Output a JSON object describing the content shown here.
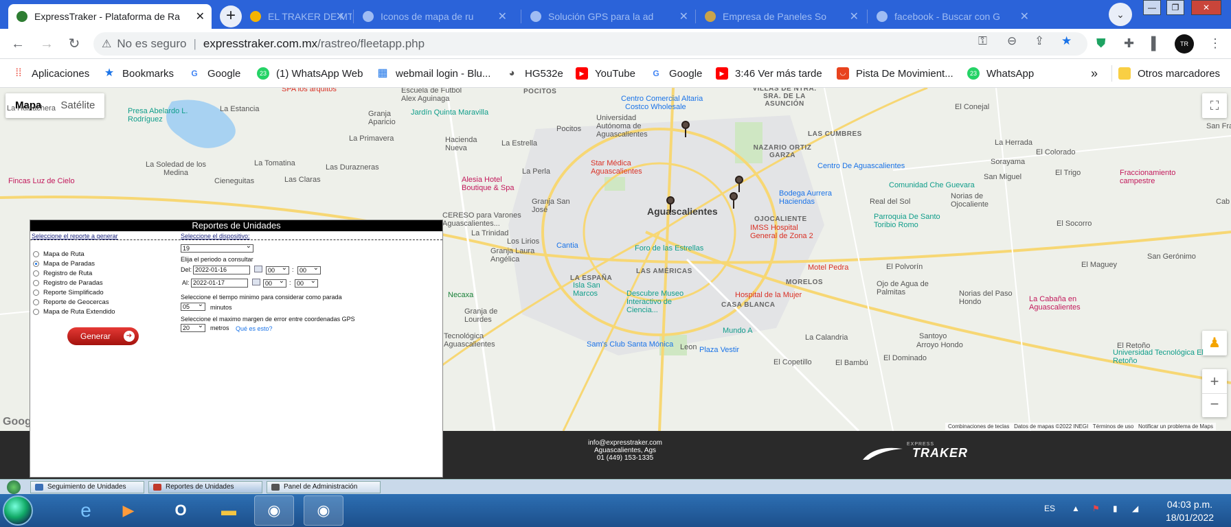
{
  "browser": {
    "tabs": [
      {
        "title": "ExpressTraker - Plataforma de Ra",
        "active": true
      },
      {
        "title": "EL TRAKER DE MT"
      },
      {
        "title": "Iconos de mapa de ru"
      },
      {
        "title": "Solución GPS para la ad"
      },
      {
        "title": "Empresa de Paneles So"
      },
      {
        "title": "facebook - Buscar con G"
      }
    ],
    "new_tab": "+",
    "close_glyph": "✕",
    "window_controls": {
      "minimize": "—",
      "restore": "❐",
      "close": "✕"
    }
  },
  "address_bar": {
    "security_label": "No es seguro",
    "domain": "expresstraker.com.mx",
    "path": "/rastreo/fleetapp.php"
  },
  "bookmarks": [
    {
      "label": "Aplicaciones",
      "icon": "apps-grid-icon"
    },
    {
      "label": "Bookmarks",
      "icon": "star-icon"
    },
    {
      "label": "Google",
      "icon": "google-icon"
    },
    {
      "label": "(1) WhatsApp Web",
      "icon": "whatsapp-icon",
      "badge": "23"
    },
    {
      "label": "webmail login - Blu...",
      "icon": "grid-icon"
    },
    {
      "label": "HG532e",
      "icon": "globe-icon"
    },
    {
      "label": "YouTube",
      "icon": "youtube-icon"
    },
    {
      "label": "Google",
      "icon": "google-icon"
    },
    {
      "label": "3:46 Ver más tarde",
      "icon": "youtube-icon"
    },
    {
      "label": "Pista De Movimient...",
      "icon": "tracker-icon"
    },
    {
      "label": "WhatsApp",
      "icon": "whatsapp-icon",
      "badge": "23"
    }
  ],
  "bookmarks_overflow": "»",
  "other_bookmarks": "Otros marcadores",
  "map": {
    "type_buttons": {
      "map": "Mapa",
      "satellite": "Satélite"
    },
    "zoom_in": "+",
    "zoom_out": "−",
    "attribution": [
      "Combinaciones de teclas",
      "Datos de mapas ©2022 INEGI",
      "Términos de uso",
      "Notificar un problema de Maps"
    ],
    "google_word": "Goog",
    "city": "Aguascalientes",
    "labels": [
      "Centro Comercial Altaria",
      "Costco Wholesale",
      "Universidad Autónoma de Aguascalientes",
      "Star Médica Aguascalientes",
      "Escuela de Futbol Alex Aguinaga",
      "Jardín Quinta Maravilla",
      "Presa Abelardo L. Rodríguez",
      "La Estancia",
      "La Huizachera",
      "La Primavera",
      "Hacienda Nueva",
      "La Estrella",
      "Granja Aparicio",
      "Pocitos",
      "La Soledad de los Medina",
      "La Tomatina",
      "Las Durazneras",
      "Fincas Luz de Cielo",
      "Cieneguitas",
      "Las Claras",
      "Alesia Hotel Boutique & Spa",
      "La Perla",
      "Granja San José",
      "CERESO para Varones Aguascalientes...",
      "La Trinidad",
      "Los Lirios",
      "Granja Laura Angélica",
      "Cantia",
      "Foro de las Estrellas",
      "LAS AMÉRICAS",
      "LA ESPAÑA",
      "Isla San Marcos",
      "Descubre Museo Interactivo de Ciencia...",
      "Hospital de la Mujer",
      "CASA BLANCA",
      "Mundo A",
      "Leon",
      "Sam's Club Santa Mónica",
      "Plaza Vestir",
      "Tecnológica Aguascalientes",
      "Necaxa",
      "Granja de Lourdes",
      "IMSS Hospital General de Zona 2",
      "Motel Pedra",
      "MORELOS",
      "OJOCALIENTE",
      "NAZARIO ORTIZ GARZA",
      "LAS CUMBRES",
      "Centro De Aguascalientes",
      "Bodega Aurrera Haciendas",
      "Comunidad Che Guevara",
      "Real del Sol",
      "Parroquia De Santo Toribio Romo",
      "El Polvorín",
      "Ojo de Agua de Palmitas",
      "La Herrada",
      "Sorayama",
      "El Colorado",
      "San Miguel",
      "Norias de Ojocaliente",
      "El Trigo",
      "Fraccionamiento campestre",
      "El Socorro",
      "San Gerónimo",
      "El Maguey",
      "Norias del Paso Hondo",
      "La Cabaña en Aguascalientes",
      "Santoyo",
      "Arroyo Hondo",
      "El Retoño",
      "Universidad Tecnológica El Retoño",
      "La Calandria",
      "El Copetillo",
      "El Bambú",
      "El Dominado",
      "El Conejal",
      "POCITOS",
      "VILLAS DE NTRA. SRA. DE LA ASUNCIÓN",
      "SPA los arquitos",
      "San Fra",
      "Cab"
    ]
  },
  "report": {
    "title": "Reportes de Unidades",
    "report_header": "Seleccione el reporte a generar",
    "device_header": "Seleccione el dispositivo:",
    "options": [
      "Mapa de Ruta",
      "Mapa de Paradas",
      "Registro de Ruta",
      "Registro de Paradas",
      "Reporte Simplificado",
      "Reporte de Geocercas",
      "Mapa de Ruta Extendido"
    ],
    "selected_option": "Mapa de Paradas",
    "device_value": "19",
    "period_label": "Elija el periodo a consultar",
    "from_label": "Del:",
    "from_date": "2022-01-16",
    "from_hour": "00",
    "from_min": "00",
    "to_label": "Al:",
    "to_date": "2022-01-17",
    "to_hour": "00",
    "to_min": "00",
    "time_sep": ":",
    "min_time_label": "Seleccione el tiempo minimo para considerar como parada",
    "min_time_value": "05",
    "min_time_unit": "minutos",
    "margin_label": "Seleccione el maximo margen de error entre coordenadas GPS",
    "margin_value": "20",
    "margin_unit": "metros",
    "help_link": "Qué es esto?",
    "generate_button": "Generar"
  },
  "footer": {
    "email": "info@expresstraker.com",
    "city": "Aguascalientes, Ags",
    "phone": "01 (449) 153-1335",
    "logo": "TRAKER",
    "logo_small": "EXPRESS"
  },
  "appbar": [
    {
      "label": "Seguimiento de Unidades"
    },
    {
      "label": "Reportes de Unidades",
      "active": true
    },
    {
      "label": "Panel de Administración"
    }
  ],
  "taskbar": {
    "language": "ES",
    "time": "04:03 p.m.",
    "date": "18/01/2022"
  },
  "colors": {
    "tabstrip": "#2b63d9",
    "footer": "#2a2a2a",
    "generate": "#c62828",
    "link": "#1a73e8"
  }
}
